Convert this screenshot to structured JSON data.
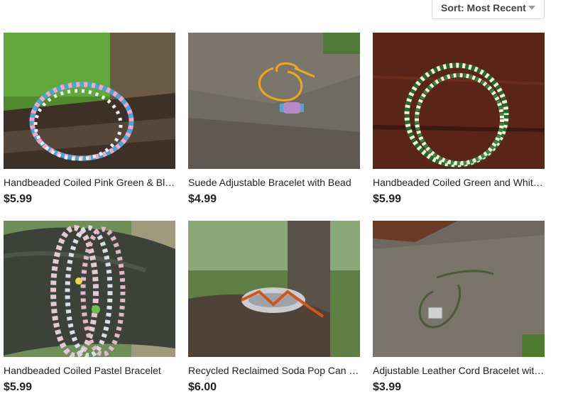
{
  "sort": {
    "label": "Sort: Most Recent"
  },
  "listings": [
    {
      "title": "Handbeaded Coiled Pink Green & Blue Memory Wire Bracelet",
      "price": "$5.99",
      "image": "coiled-bead-bracelet-on-branch"
    },
    {
      "title": "Suede Adjustable Bracelet with Bead",
      "price": "$4.99",
      "image": "yellow-cord-bracelet-on-rock"
    },
    {
      "title": "Handbeaded Coiled Green and White Bracelet",
      "price": "$5.99",
      "image": "green-white-bead-bracelet-on-wood"
    },
    {
      "title": "Handbeaded Coiled Pastel Bracelet",
      "price": "$5.99",
      "image": "pastel-bead-bracelet-on-branch"
    },
    {
      "title": "Recycled Reclaimed Soda Pop Can Tab Bracelet",
      "price": "$6.00",
      "image": "pop-tab-bracelet-on-log"
    },
    {
      "title": "Adjustable Leather Cord Bracelet with Charm",
      "price": "$3.99",
      "image": "leather-cord-bracelet-on-rock"
    }
  ],
  "colors": {
    "text": "#222222",
    "border": "#d8d8d8",
    "caret": "#9a9a9a"
  }
}
